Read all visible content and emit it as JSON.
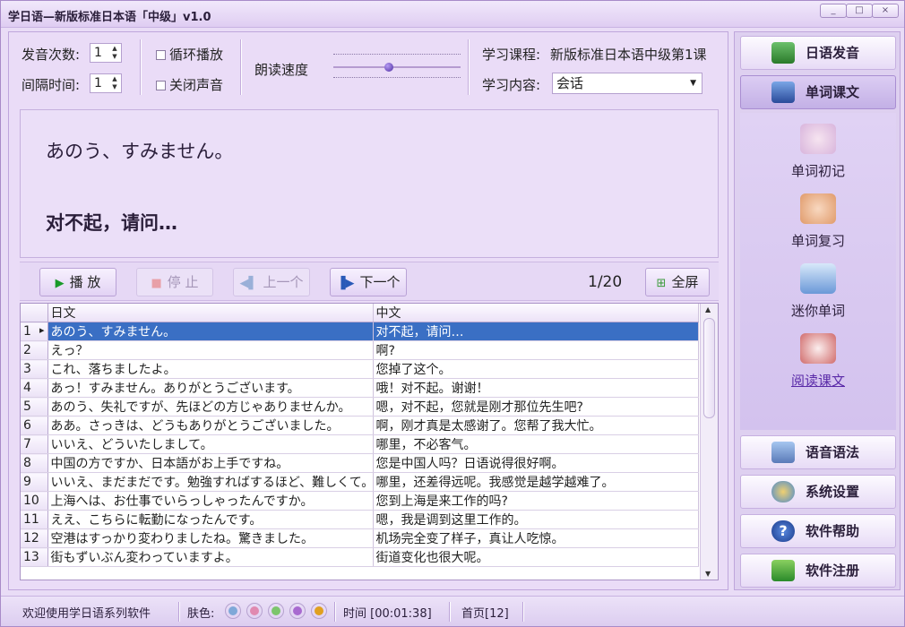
{
  "window": {
    "title": "学日语—新版标准日本语「中级」v1.0",
    "minimize": "_",
    "restore": "□",
    "close": "×"
  },
  "controls": {
    "repeat_label": "发音次数:",
    "repeat_value": "1",
    "interval_label": "间隔时间:",
    "interval_value": "1",
    "loop_label": "循环播放",
    "mute_label": "关闭声音",
    "speed_label": "朗读速度",
    "course_label": "学习课程:",
    "course_value": "新版标准日本语中级第1课",
    "content_label": "学习内容:",
    "content_value": "会话"
  },
  "display": {
    "japanese": "あのう、すみません。",
    "chinese": "对不起，请问…"
  },
  "playback": {
    "play": "播 放",
    "stop": "停 止",
    "prev": "上一个",
    "next": "下一个",
    "counter": "1/20",
    "fullscreen": "全屏"
  },
  "table": {
    "columns": [
      "日文",
      "中文"
    ],
    "selected_index": 0,
    "rows": [
      {
        "n": "1",
        "jp": "あのう、すみません。",
        "cn": "对不起，请问…"
      },
      {
        "n": "2",
        "jp": "えっ？",
        "cn": "啊?"
      },
      {
        "n": "3",
        "jp": "これ、落ちましたよ。",
        "cn": "您掉了这个。"
      },
      {
        "n": "4",
        "jp": "あっ！すみません。ありがとうございます。",
        "cn": "哦！对不起。谢谢！"
      },
      {
        "n": "5",
        "jp": "あのう、失礼ですが、先ほどの方じゃありませんか。",
        "cn": "嗯，对不起，您就是刚才那位先生吧?"
      },
      {
        "n": "6",
        "jp": "ああ。さっきは、どうもありがとうございました。",
        "cn": "啊，刚才真是太感谢了。您帮了我大忙。"
      },
      {
        "n": "7",
        "jp": "いいえ、どういたしまして。",
        "cn": "哪里，不必客气。"
      },
      {
        "n": "8",
        "jp": "中国の方ですか、日本語がお上手ですね。",
        "cn": "您是中国人吗？日语说得很好啊。"
      },
      {
        "n": "9",
        "jp": "いいえ、まだまだです。勉強すればするほど、難しくて。",
        "cn": "哪里，还差得远呢。我感觉是越学越难了。"
      },
      {
        "n": "10",
        "jp": "上海へは、お仕事でいらっしゃったんですか。",
        "cn": "您到上海是来工作的吗?"
      },
      {
        "n": "11",
        "jp": "ええ、こちらに転勤になったんです。",
        "cn": "嗯，我是调到这里工作的。"
      },
      {
        "n": "12",
        "jp": "空港はすっかり変わりましたね。驚きました。",
        "cn": "机场完全变了样子，真让人吃惊。"
      },
      {
        "n": "13",
        "jp": "街もずいぶん変わっていますよ。",
        "cn": "街道变化也很大呢。"
      }
    ]
  },
  "sidebar": {
    "pronunciation": "日语发音",
    "lessons": "单词课文",
    "sub": {
      "first": "单词初记",
      "review": "单词复习",
      "mini": "迷你单词",
      "read": "阅读课文"
    },
    "grammar": "语音语法",
    "settings": "系统设置",
    "help": "软件帮助",
    "register": "软件注册"
  },
  "status": {
    "welcome": "欢迎使用学日语系列软件",
    "skin_label": "肤色:",
    "skins": [
      "#7fa8d8",
      "#e08ab0",
      "#7cc56c",
      "#a86ad0",
      "#e0a020"
    ],
    "time": "时间 [00:01:38]",
    "page": "首页[12]"
  }
}
